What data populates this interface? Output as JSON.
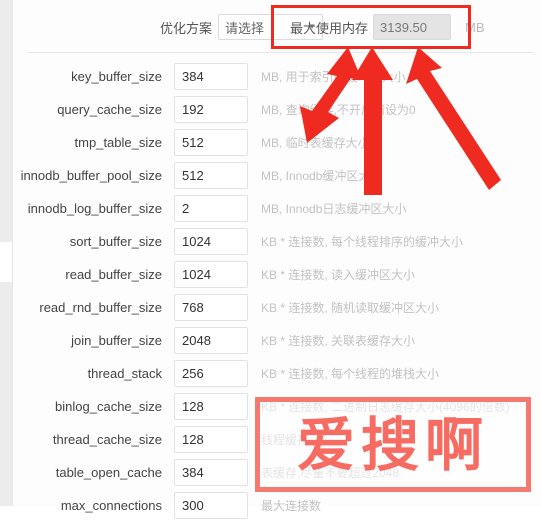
{
  "header": {
    "scheme_label": "优化方案",
    "scheme_value": "请选择",
    "scheme_caret": "chevron-down-icon",
    "memory_label": "最大使用内存",
    "memory_value": "3139.50",
    "memory_unit": "MB"
  },
  "rows": [
    {
      "label": "key_buffer_size",
      "value": "384",
      "hint": "MB, 用于索引的缓冲区大小"
    },
    {
      "label": "query_cache_size",
      "value": "192",
      "hint": "MB, 查询缓存,不开启请设为0"
    },
    {
      "label": "tmp_table_size",
      "value": "512",
      "hint": "MB, 临时表缓存大小"
    },
    {
      "label": "innodb_buffer_pool_size",
      "value": "512",
      "hint": "MB, Innodb缓冲区大小"
    },
    {
      "label": "innodb_log_buffer_size",
      "value": "2",
      "hint": "MB, Innodb日志缓冲区大小"
    },
    {
      "label": "sort_buffer_size",
      "value": "1024",
      "hint": "KB * 连接数, 每个线程排序的缓冲大小"
    },
    {
      "label": "read_buffer_size",
      "value": "1024",
      "hint": "KB * 连接数, 读入缓冲区大小"
    },
    {
      "label": "read_rnd_buffer_size",
      "value": "768",
      "hint": "KB * 连接数, 随机读取缓冲区大小"
    },
    {
      "label": "join_buffer_size",
      "value": "2048",
      "hint": "KB * 连接数, 关联表缓存大小"
    },
    {
      "label": "thread_stack",
      "value": "256",
      "hint": "KB * 连接数, 每个线程的堆栈大小"
    },
    {
      "label": "binlog_cache_size",
      "value": "128",
      "hint": "KB * 连接数, 二进制日志缓存大小(4096的倍数)"
    },
    {
      "label": "thread_cache_size",
      "value": "128",
      "hint": "线程缓存"
    },
    {
      "label": "table_open_cache",
      "value": "384",
      "hint": "表缓存,尽量不要超过2048"
    },
    {
      "label": "max_connections",
      "value": "300",
      "hint": "最大连接数"
    }
  ],
  "annotations": {
    "highlight_color": "#ef2b21",
    "arrow_color": "#ef2b21",
    "arrow_count": 3
  },
  "watermark": {
    "text": "爱搜啊",
    "border_color": "#f4796f",
    "text_color": "#f76055"
  }
}
